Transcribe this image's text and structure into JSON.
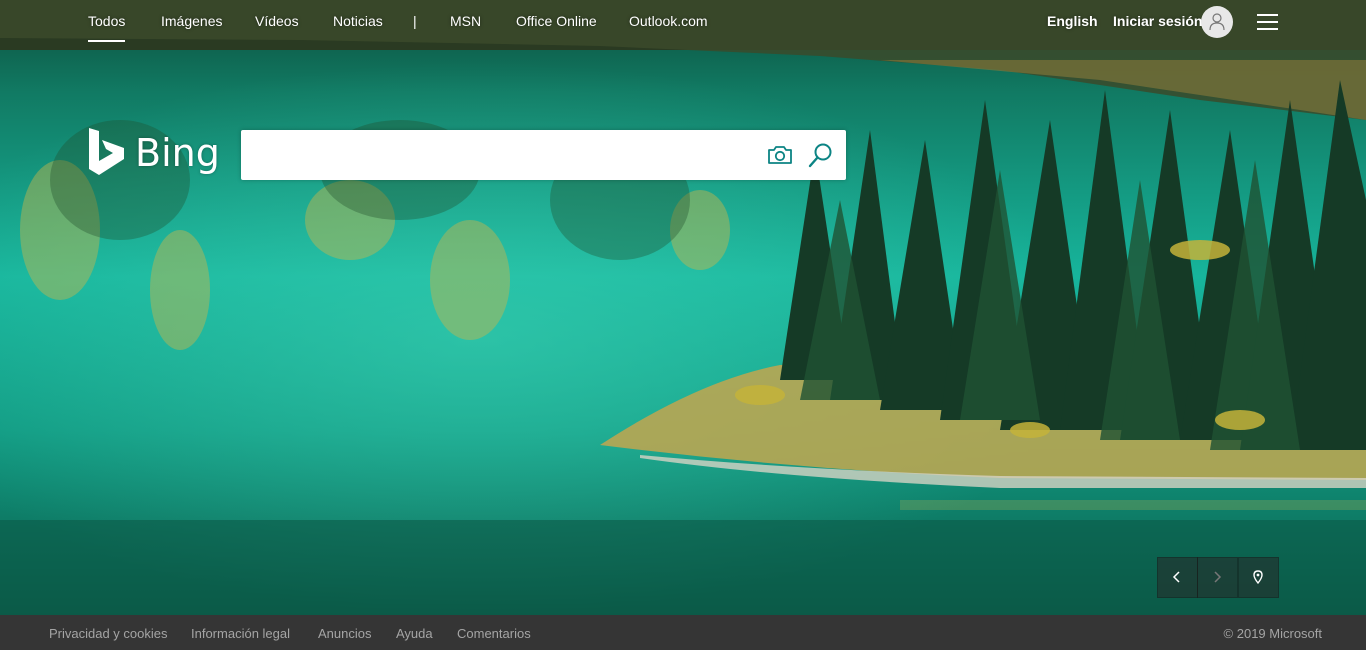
{
  "nav": {
    "items": [
      {
        "label": "Todos",
        "active": true
      },
      {
        "label": "Imágenes"
      },
      {
        "label": "Vídeos"
      },
      {
        "label": "Noticias"
      }
    ],
    "separator": "|",
    "extra_items": [
      {
        "label": "MSN"
      },
      {
        "label": "Office Online"
      },
      {
        "label": "Outlook.com"
      }
    ]
  },
  "header_right": {
    "language": "English",
    "signin": "Iniciar sesión",
    "avatar_icon": "person-icon",
    "menu_icon": "hamburger-icon"
  },
  "logo": {
    "text": "Bing"
  },
  "search": {
    "value": "",
    "placeholder": "",
    "camera_icon": "camera-icon",
    "search_icon": "magnifier-icon",
    "accent_color": "#0c8484"
  },
  "carousel": {
    "prev_icon": "chevron-left-icon",
    "next_icon": "chevron-right-icon",
    "location_icon": "location-pin-icon"
  },
  "footer": {
    "links": [
      {
        "label": "Privacidad y cookies"
      },
      {
        "label": "Información legal"
      },
      {
        "label": "Anuncios"
      },
      {
        "label": "Ayuda"
      },
      {
        "label": "Comentarios"
      }
    ],
    "copyright": "© 2019 Microsoft",
    "background": "#353535"
  }
}
